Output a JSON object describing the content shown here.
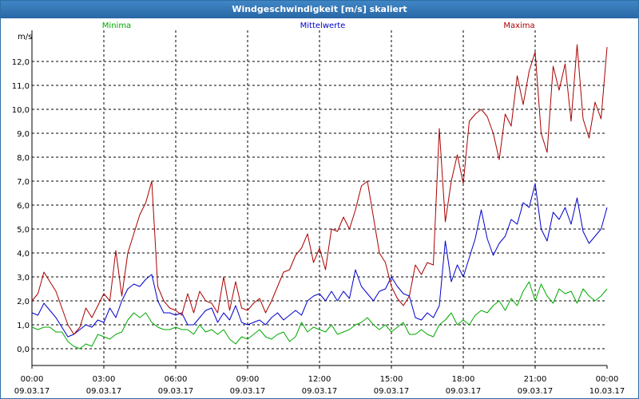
{
  "window": {
    "title": "Windgeschwindigkeit [m/s] skaliert"
  },
  "chart_data": {
    "type": "line",
    "title": "Windgeschwindigkeit [m/s] skaliert",
    "ylabel": "m/s",
    "ylim": [
      -0.7,
      13.3
    ],
    "xlim_hours": [
      0,
      24
    ],
    "grid": true,
    "legend": "top",
    "y_ticks": [
      "0,0",
      "1,0",
      "2,0",
      "3,0",
      "4,0",
      "5,0",
      "6,0",
      "7,0",
      "8,0",
      "9,0",
      "10,0",
      "11,0",
      "12,0"
    ],
    "x_ticks": [
      {
        "time": "00:00",
        "date": "09.03.17"
      },
      {
        "time": "03:00",
        "date": "09.03.17"
      },
      {
        "time": "06:00",
        "date": "09.03.17"
      },
      {
        "time": "09:00",
        "date": "09.03.17"
      },
      {
        "time": "12:00",
        "date": "09.03.17"
      },
      {
        "time": "15:00",
        "date": "09.03.17"
      },
      {
        "time": "18:00",
        "date": "09.03.17"
      },
      {
        "time": "21:00",
        "date": "09.03.17"
      },
      {
        "time": "00:00",
        "date": "10.03.17"
      }
    ],
    "colors": {
      "Minima": "#00aa00",
      "Mittelwerte": "#0000cc",
      "Maxima": "#aa0000"
    },
    "series": [
      {
        "name": "Minima",
        "x": [
          0,
          0.25,
          0.5,
          0.75,
          1,
          1.25,
          1.5,
          1.75,
          2,
          2.25,
          2.5,
          2.75,
          3,
          3.25,
          3.5,
          3.75,
          4,
          4.25,
          4.5,
          4.75,
          5,
          5.25,
          5.5,
          5.75,
          6,
          6.25,
          6.5,
          6.75,
          7,
          7.25,
          7.5,
          7.75,
          8,
          8.25,
          8.5,
          8.75,
          9,
          9.25,
          9.5,
          9.75,
          10,
          10.25,
          10.5,
          10.75,
          11,
          11.25,
          11.5,
          11.75,
          12,
          12.25,
          12.5,
          12.75,
          13,
          13.25,
          13.5,
          13.75,
          14,
          14.25,
          14.5,
          14.75,
          15,
          15.25,
          15.5,
          15.75,
          16,
          16.25,
          16.5,
          16.75,
          17,
          17.25,
          17.5,
          17.75,
          18,
          18.25,
          18.5,
          18.75,
          19,
          19.25,
          19.5,
          19.75,
          20,
          20.25,
          20.5,
          20.75,
          21,
          21.25,
          21.5,
          21.75,
          22,
          22.25,
          22.5,
          22.75,
          23,
          23.25,
          23.5,
          23.75,
          24
        ],
        "values": [
          0.9,
          0.8,
          0.9,
          0.9,
          0.7,
          0.7,
          0.3,
          0.1,
          0.0,
          0.2,
          0.1,
          0.6,
          0.5,
          0.4,
          0.6,
          0.7,
          1.2,
          1.5,
          1.3,
          1.5,
          1.1,
          0.9,
          0.8,
          0.8,
          0.9,
          0.8,
          0.8,
          0.6,
          1.0,
          0.7,
          0.8,
          0.6,
          0.8,
          0.4,
          0.2,
          0.5,
          0.4,
          0.6,
          0.8,
          0.5,
          0.4,
          0.6,
          0.7,
          0.3,
          0.5,
          1.1,
          0.7,
          0.9,
          0.8,
          0.7,
          1.0,
          0.6,
          0.7,
          0.8,
          1.0,
          1.1,
          1.3,
          1.0,
          0.8,
          1.0,
          0.7,
          0.9,
          1.1,
          0.6,
          0.6,
          0.8,
          0.6,
          0.5,
          1.0,
          1.2,
          1.5,
          1.0,
          1.2,
          1.0,
          1.4,
          1.6,
          1.5,
          1.8,
          2.0,
          1.6,
          2.1,
          1.8,
          2.4,
          2.8,
          2.0,
          2.7,
          2.2,
          1.9,
          2.5,
          2.3,
          2.4,
          1.9,
          2.5,
          2.2,
          2.0,
          2.2,
          2.5
        ]
      },
      {
        "name": "Mittelwerte",
        "x": [
          0,
          0.25,
          0.5,
          0.75,
          1,
          1.25,
          1.5,
          1.75,
          2,
          2.25,
          2.5,
          2.75,
          3,
          3.25,
          3.5,
          3.75,
          4,
          4.25,
          4.5,
          4.75,
          5,
          5.25,
          5.5,
          5.75,
          6,
          6.25,
          6.5,
          6.75,
          7,
          7.25,
          7.5,
          7.75,
          8,
          8.25,
          8.5,
          8.75,
          9,
          9.25,
          9.5,
          9.75,
          10,
          10.25,
          10.5,
          10.75,
          11,
          11.25,
          11.5,
          11.75,
          12,
          12.25,
          12.5,
          12.75,
          13,
          13.25,
          13.5,
          13.75,
          14,
          14.25,
          14.5,
          14.75,
          15,
          15.25,
          15.5,
          15.75,
          16,
          16.25,
          16.5,
          16.75,
          17,
          17.25,
          17.5,
          17.75,
          18,
          18.25,
          18.5,
          18.75,
          19,
          19.25,
          19.5,
          19.75,
          20,
          20.25,
          20.5,
          20.75,
          21,
          21.25,
          21.5,
          21.75,
          22,
          22.25,
          22.5,
          22.75,
          23,
          23.25,
          23.5,
          23.75,
          24
        ],
        "values": [
          1.5,
          1.4,
          1.9,
          1.6,
          1.3,
          0.9,
          0.5,
          0.6,
          0.8,
          1.0,
          0.9,
          1.2,
          1.1,
          1.7,
          1.3,
          2.0,
          2.5,
          2.7,
          2.6,
          2.9,
          3.1,
          2.0,
          1.5,
          1.5,
          1.4,
          1.5,
          1.0,
          1.0,
          1.3,
          1.6,
          1.7,
          1.1,
          1.5,
          1.2,
          1.8,
          1.1,
          1.0,
          1.1,
          1.2,
          1.0,
          1.3,
          1.5,
          1.2,
          1.4,
          1.6,
          1.4,
          2.0,
          2.2,
          2.3,
          2.0,
          2.4,
          2.0,
          2.4,
          2.1,
          3.3,
          2.6,
          2.3,
          2.0,
          2.4,
          2.5,
          3.0,
          2.6,
          2.3,
          2.2,
          1.3,
          1.2,
          1.5,
          1.3,
          1.8,
          4.5,
          2.8,
          3.5,
          3.0,
          3.8,
          4.6,
          5.8,
          4.6,
          3.9,
          4.4,
          4.7,
          5.4,
          5.2,
          6.1,
          5.9,
          6.9,
          5.0,
          4.5,
          5.7,
          5.4,
          5.9,
          5.2,
          6.3,
          4.9,
          4.4,
          4.7,
          5.0,
          5.9
        ]
      },
      {
        "name": "Maxima",
        "x": [
          0,
          0.25,
          0.5,
          0.75,
          1,
          1.25,
          1.5,
          1.75,
          2,
          2.25,
          2.5,
          2.75,
          3,
          3.25,
          3.5,
          3.75,
          4,
          4.25,
          4.5,
          4.75,
          5,
          5.25,
          5.5,
          5.75,
          6,
          6.25,
          6.5,
          6.75,
          7,
          7.25,
          7.5,
          7.75,
          8,
          8.25,
          8.5,
          8.75,
          9,
          9.25,
          9.5,
          9.75,
          10,
          10.25,
          10.5,
          10.75,
          11,
          11.25,
          11.5,
          11.75,
          12,
          12.25,
          12.5,
          12.75,
          13,
          13.25,
          13.5,
          13.75,
          14,
          14.25,
          14.5,
          14.75,
          15,
          15.25,
          15.5,
          15.75,
          16,
          16.25,
          16.5,
          16.75,
          17,
          17.25,
          17.5,
          17.75,
          18,
          18.25,
          18.5,
          18.75,
          19,
          19.25,
          19.5,
          19.75,
          20,
          20.25,
          20.5,
          20.75,
          21,
          21.25,
          21.5,
          21.75,
          22,
          22.25,
          22.5,
          22.75,
          23,
          23.25,
          23.5,
          23.75,
          24
        ],
        "values": [
          2.0,
          2.3,
          3.2,
          2.8,
          2.4,
          1.7,
          1.0,
          0.6,
          0.9,
          1.7,
          1.3,
          1.8,
          2.3,
          2.0,
          4.1,
          2.2,
          4.0,
          4.8,
          5.6,
          6.1,
          7.0,
          2.6,
          2.0,
          1.7,
          1.6,
          1.4,
          2.3,
          1.5,
          2.4,
          2.0,
          1.9,
          1.5,
          3.0,
          1.6,
          2.8,
          1.7,
          1.6,
          1.9,
          2.1,
          1.5,
          2.0,
          2.6,
          3.2,
          3.3,
          3.9,
          4.2,
          4.8,
          3.6,
          4.2,
          3.3,
          5.0,
          4.9,
          5.5,
          5.0,
          5.8,
          6.8,
          7.0,
          5.5,
          4.0,
          3.6,
          2.6,
          2.1,
          1.8,
          2.2,
          3.5,
          3.1,
          3.6,
          3.5,
          9.2,
          5.3,
          7.0,
          8.1,
          6.9,
          9.5,
          9.8,
          10.0,
          9.7,
          9.0,
          7.9,
          9.8,
          9.3,
          11.4,
          10.2,
          11.6,
          12.4,
          9.0,
          8.2,
          11.8,
          10.8,
          11.9,
          9.5,
          12.7,
          9.6,
          8.8,
          10.3,
          9.6,
          12.6
        ]
      }
    ]
  }
}
